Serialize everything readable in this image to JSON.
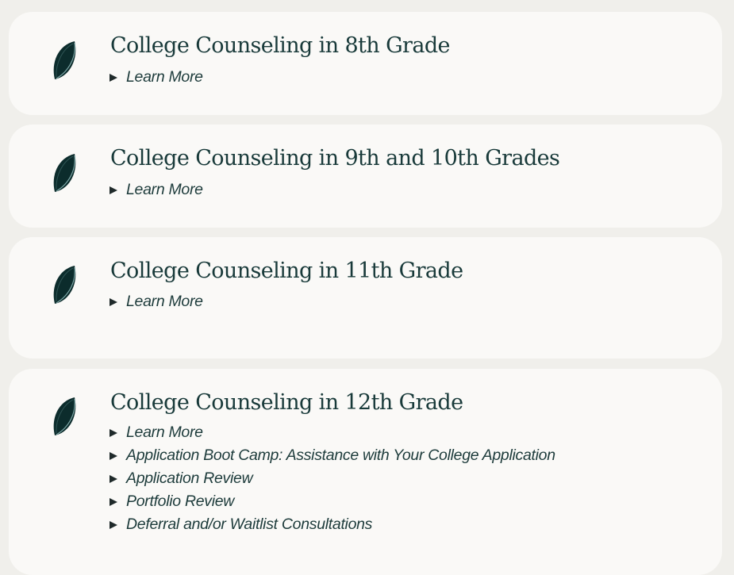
{
  "icon": "leaf-icon",
  "colors": {
    "page_bg": "#f0efeb",
    "card_bg": "#faf9f7",
    "title": "#193a3a",
    "leaf": "#0c2c2c"
  },
  "cards": [
    {
      "title": "College Counseling in 8th Grade",
      "links": [
        "Learn More"
      ]
    },
    {
      "title": "College Counseling in 9th and 10th Grades",
      "links": [
        "Learn More"
      ]
    },
    {
      "title": "College Counseling in 11th Grade",
      "links": [
        "Learn More"
      ]
    },
    {
      "title": "College Counseling in 12th Grade",
      "links": [
        "Learn More",
        "Application Boot Camp: Assistance with Your College Application",
        "Application Review",
        "Portfolio Review",
        "Deferral and/or Waitlist Consultations"
      ]
    }
  ]
}
